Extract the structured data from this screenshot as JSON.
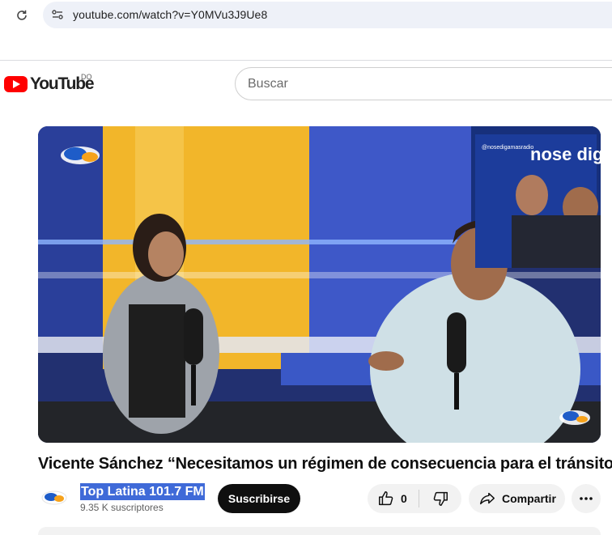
{
  "browser": {
    "url": "youtube.com/watch?v=Y0MVu3J9Ue8"
  },
  "header": {
    "logo_text": "YouTube",
    "country_code": "DO",
    "search_placeholder": "Buscar"
  },
  "video": {
    "overlay_handle": "@nosedigamasradio",
    "overlay_show": "nose digamos",
    "overlay_logo": "top latina"
  },
  "info": {
    "title": "Vicente Sánchez “Necesitamos un régimen de consecuencia para el tránsito”",
    "channel_name": "Top Latina 101.7 FM",
    "subscribers": "9.35 K suscriptores",
    "subscribe_label": "Suscribirse",
    "like_count": "0",
    "share_label": "Compartir"
  },
  "colors": {
    "youtube_red": "#ff0000",
    "subscribe_bg": "#0f0f0f",
    "selection_highlight": "#3f6ad8"
  }
}
